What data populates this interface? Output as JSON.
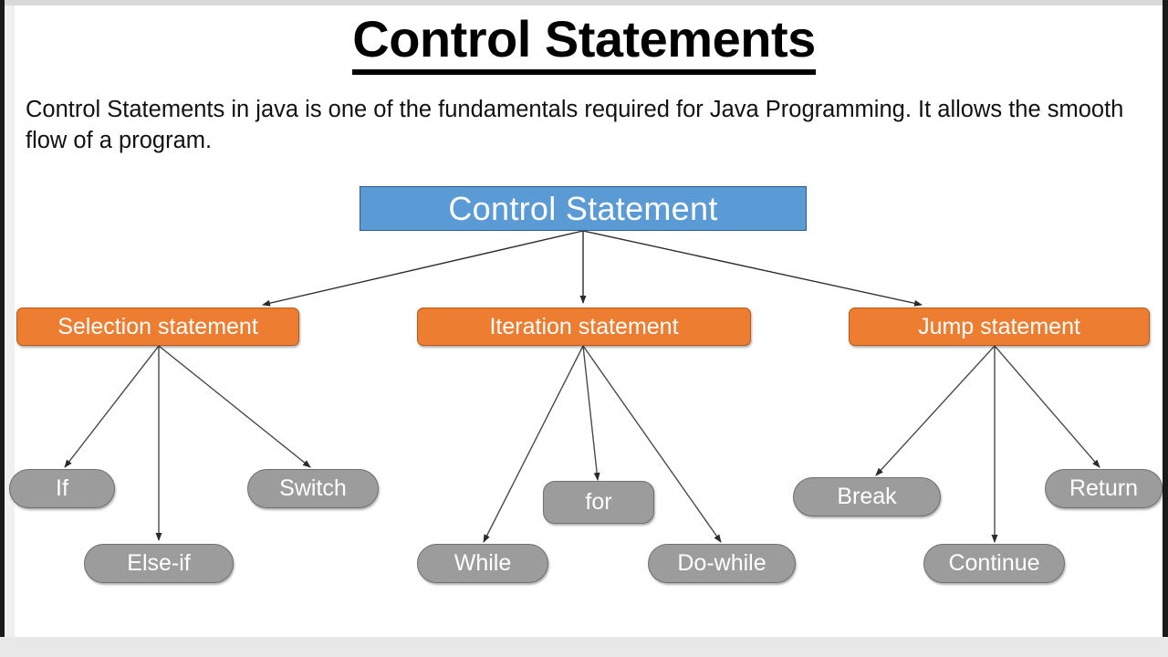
{
  "slide": {
    "title": "Control Statements",
    "intro": "Control Statements in java is one of the fundamentals required for Java Programming. It allows the smooth flow of a program."
  },
  "colors": {
    "root_fill": "#5B9BD5",
    "root_border": "#2E5B8A",
    "mid_fill": "#ED7D31",
    "mid_border": "#B55A18",
    "leaf_fill": "#9C9C9C",
    "leaf_border": "#6F6F6F",
    "connector": "#404040",
    "text_on_shape": "#FFFFFF",
    "body_text": "#111111"
  },
  "diagram": {
    "type": "tree",
    "root": {
      "label": "Control Statement"
    },
    "branches": [
      {
        "label": "Selection statement",
        "children": [
          {
            "label": "If"
          },
          {
            "label": "Else-if"
          },
          {
            "label": "Switch"
          }
        ]
      },
      {
        "label": "Iteration statement",
        "children": [
          {
            "label": "While"
          },
          {
            "label": "for"
          },
          {
            "label": "Do-while"
          }
        ]
      },
      {
        "label": "Jump statement",
        "children": [
          {
            "label": "Break"
          },
          {
            "label": "Continue"
          },
          {
            "label": "Return"
          }
        ]
      }
    ]
  }
}
